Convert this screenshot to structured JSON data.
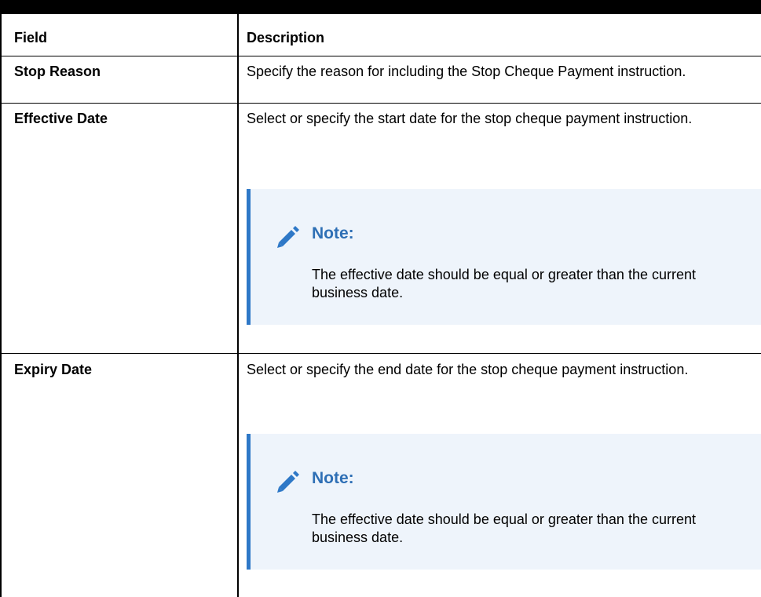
{
  "table": {
    "headers": {
      "field": "Field",
      "description": "Description"
    },
    "rows": [
      {
        "field": "Stop Reason",
        "description": "Specify the reason for including the Stop Cheque Payment instruction."
      },
      {
        "field": "Effective Date",
        "description": "Select or specify the start date for the stop cheque payment instruction.",
        "note": {
          "icon": "pencil-icon",
          "title": "Note:",
          "text": "The effective date should be equal or greater than the current business date."
        }
      },
      {
        "field": "Expiry Date",
        "description": "Select or specify the end date for the stop cheque payment instruction.",
        "note": {
          "icon": "pencil-icon",
          "title": "Note:",
          "text": "The effective date should be equal or greater than the current business date."
        }
      }
    ]
  },
  "colors": {
    "note_accent": "#2e78c7",
    "note_background": "#eef4fb",
    "note_title": "#2e6fb5"
  }
}
